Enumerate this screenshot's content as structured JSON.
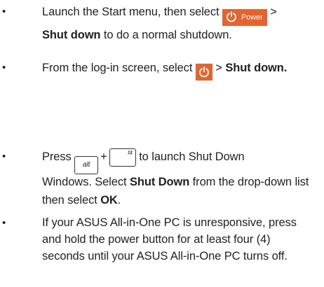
{
  "items": [
    {
      "bullet": "•",
      "pre": "Launch the Start menu, then select",
      "button_label": "Power",
      "post": " >",
      "bold": "Shut down",
      "tail": " to do a normal shutdown."
    },
    {
      "bullet": "•",
      "pre": "From the log-in screen, select",
      "post": " > ",
      "bold": "Shut down."
    },
    {
      "bullet": "•",
      "pre": "Press",
      "key1": "alt",
      "plus": "+",
      "key2": "f4",
      "post": " to launch Shut Down",
      "line2_pre": "Windows. Select ",
      "line2_bold": "Shut Down",
      "line2_post": " from the drop-down list then select ",
      "line2_bold2": "OK",
      "line2_end": "."
    },
    {
      "bullet": "•",
      "text": "If your ASUS All-in-One PC is unresponsive, press and hold the power button for at least four (4) seconds until your ASUS All-in-One PC turns off."
    }
  ],
  "colors": {
    "power_button_bg": "#e8632b",
    "text": "#231f20"
  },
  "icons": {
    "power": "power-icon"
  }
}
